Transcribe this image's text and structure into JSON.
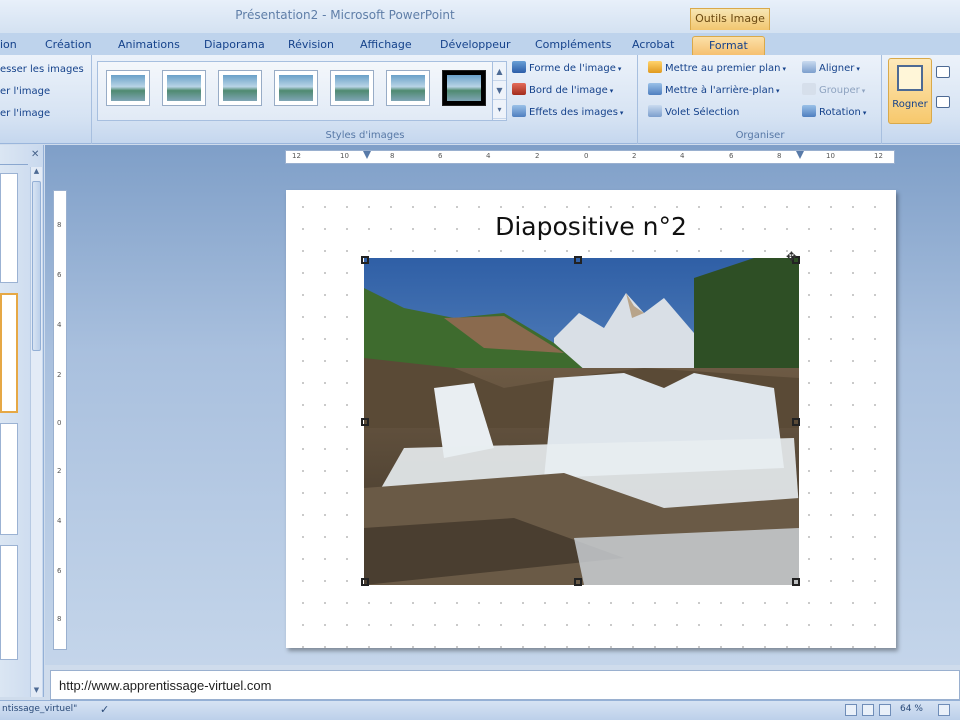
{
  "window": {
    "title": "Présentation2 - Microsoft PowerPoint",
    "context_tab_label": "Outils Image"
  },
  "tabs": [
    {
      "label": "ion"
    },
    {
      "label": "Création"
    },
    {
      "label": "Animations"
    },
    {
      "label": "Diaporama"
    },
    {
      "label": "Révision"
    },
    {
      "label": "Affichage"
    },
    {
      "label": "Développeur"
    },
    {
      "label": "Compléments"
    },
    {
      "label": "Acrobat"
    },
    {
      "label": "Format"
    }
  ],
  "ribbon": {
    "adjust_group": {
      "items": [
        "esser les images",
        "er l'image",
        "er l'image"
      ]
    },
    "styles_group": {
      "label": "Styles d'images",
      "forme": "Forme de l'image",
      "bord": "Bord de l'image",
      "effets": "Effets des images"
    },
    "arrange_group": {
      "label": "Organiser",
      "premier_plan": "Mettre au premier plan",
      "arriere_plan": "Mettre à l'arrière-plan",
      "volet": "Volet Sélection",
      "aligner": "Aligner",
      "grouper": "Grouper",
      "rotation": "Rotation"
    },
    "size_group": {
      "rogner": "Rogner"
    }
  },
  "ruler_h": [
    "12",
    "10",
    "8",
    "6",
    "4",
    "2",
    "0",
    "2",
    "4",
    "6",
    "8",
    "10",
    "12"
  ],
  "ruler_v": [
    "8",
    "6",
    "4",
    "2",
    "0",
    "2",
    "4",
    "6",
    "8"
  ],
  "slide": {
    "title": "Diapositive n°2"
  },
  "notes": {
    "text": "http://www.apprentissage-virtuel.com"
  },
  "statusbar": {
    "left_text": "ntissage_virtuel\"",
    "zoom": "64 %"
  },
  "colors": {
    "accent": "#f5c070",
    "ribbon_text": "#15428b"
  }
}
